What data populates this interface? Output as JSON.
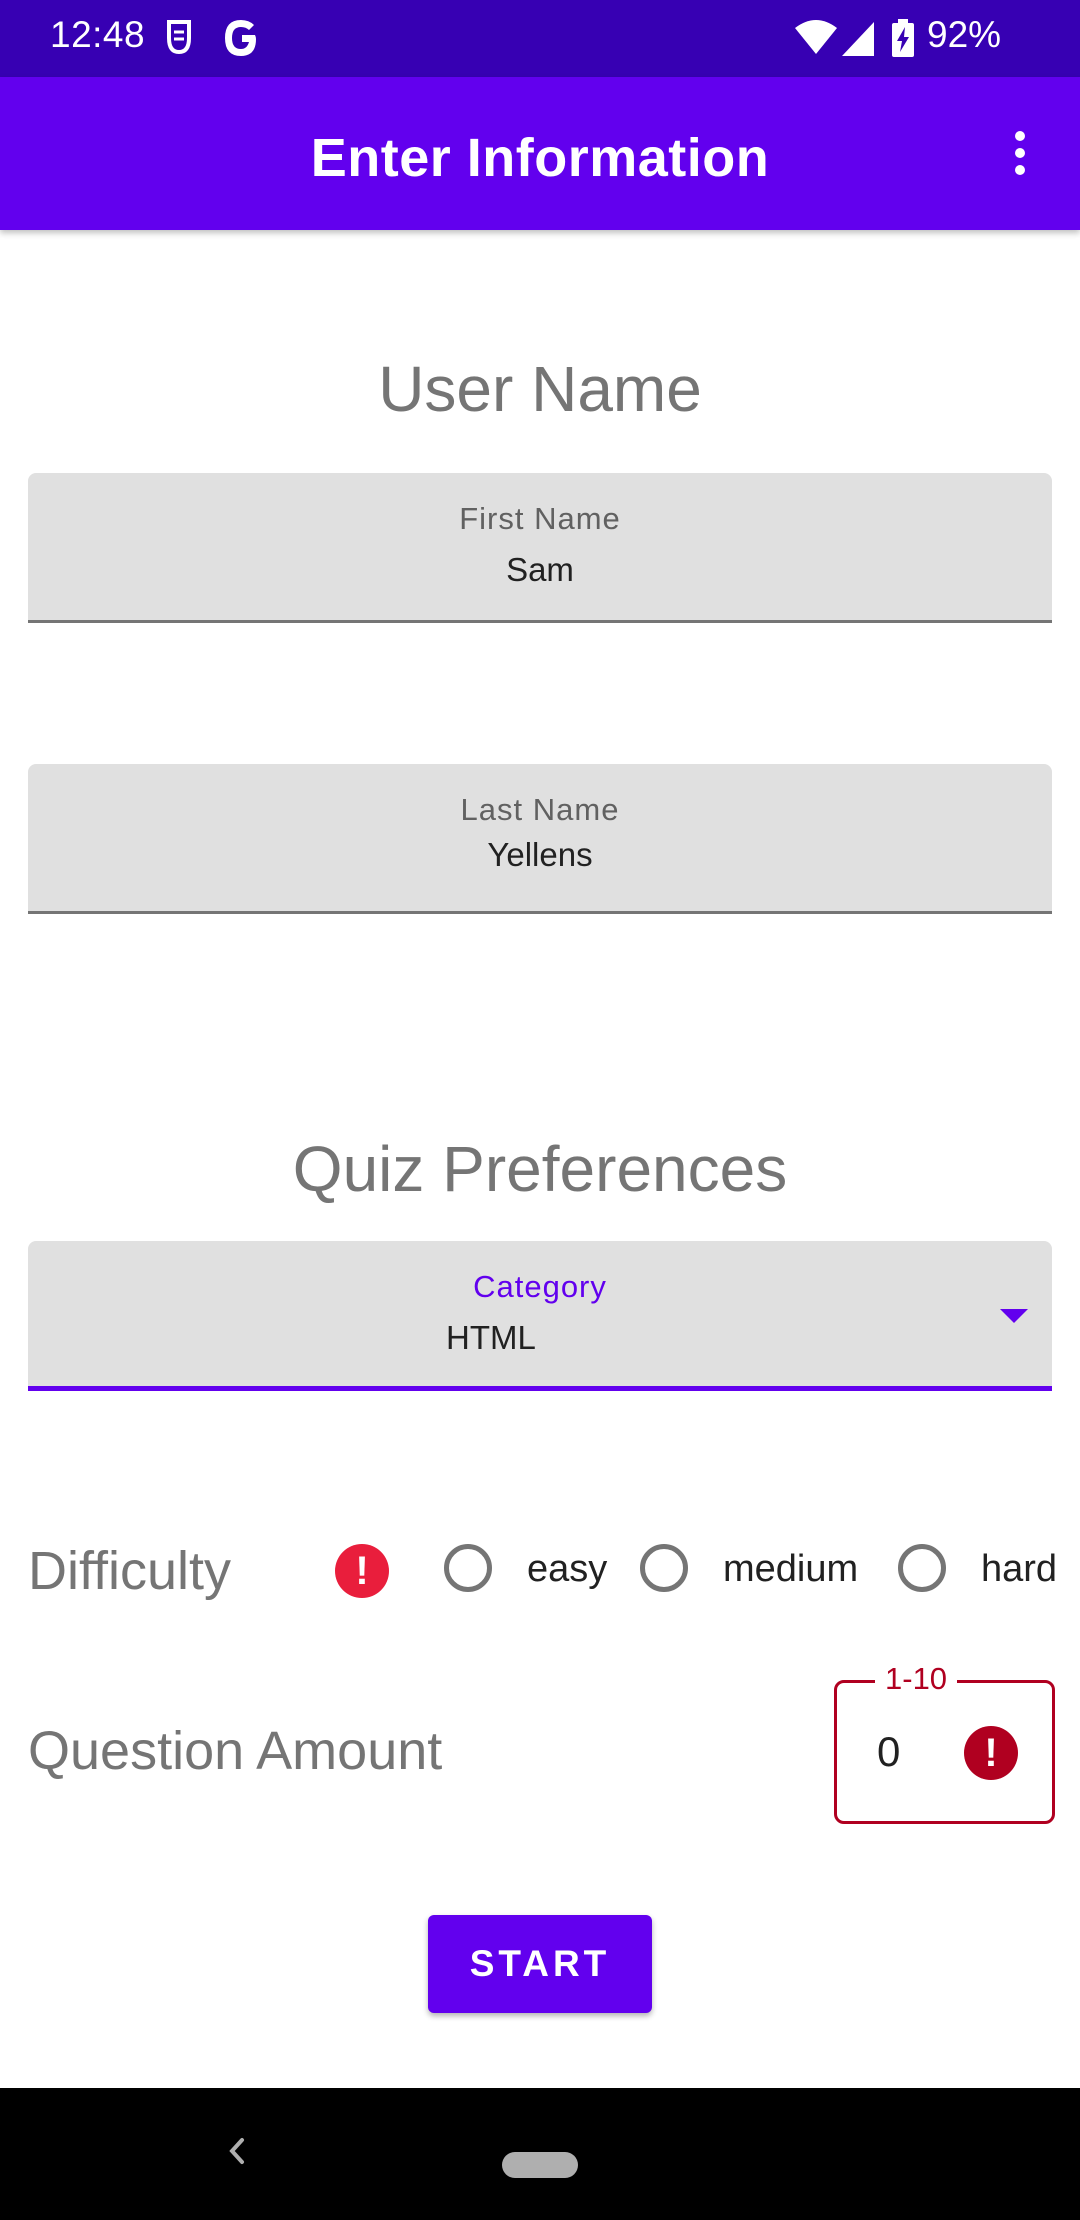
{
  "status_bar": {
    "time": "12:48",
    "battery": "92%",
    "icons": [
      "sim-icon",
      "google-icon",
      "wifi-icon",
      "signal-icon",
      "battery-charging-icon"
    ]
  },
  "app_bar": {
    "title": "Enter Information",
    "overflow_icon": "more-vert-icon"
  },
  "user_name": {
    "section_title": "User Name",
    "first_name": {
      "label": "First Name",
      "value": "Sam"
    },
    "last_name": {
      "label": "Last Name",
      "value": "Yellens"
    }
  },
  "quiz_preferences": {
    "section_title": "Quiz Preferences",
    "category": {
      "label": "Category",
      "value": "HTML"
    },
    "difficulty": {
      "label": "Difficulty",
      "error_icon": "!",
      "options": [
        "easy",
        "medium",
        "hard"
      ],
      "selected": null
    },
    "question_amount": {
      "label": "Question Amount",
      "hint": "1-10",
      "value": "0",
      "error_icon": "!"
    }
  },
  "start_button": {
    "label": "START"
  },
  "colors": {
    "primary": "#6200EE",
    "primary_dark": "#3700B3",
    "error": "#B00020",
    "error_badge": "#E91E3C"
  }
}
